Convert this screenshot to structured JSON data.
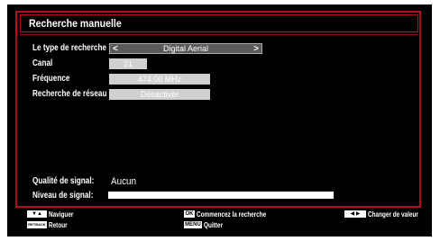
{
  "title": "Recherche manuelle",
  "rows": [
    {
      "label": "Le type de recherche",
      "value": "Digital Aerial",
      "left_arrow": "<",
      "right_arrow": ">"
    },
    {
      "label": "Canal",
      "value": "21"
    },
    {
      "label": "Fréquence",
      "value": "474.00 MHz"
    },
    {
      "label": "Recherche de réseau",
      "value": "Désactiver"
    }
  ],
  "signal_quality": {
    "label": "Qualité de signal:",
    "value": "Aucun"
  },
  "signal_level": {
    "label": "Niveau de signal:",
    "level": 1.0
  },
  "footer": {
    "navigate": {
      "key": "▼▲",
      "label": "Naviguer"
    },
    "back": {
      "key": "RETBACK",
      "label": "Retour"
    },
    "ok": {
      "key": "OK",
      "label": "Commencez la recherche"
    },
    "menu": {
      "key": "MENU",
      "label": "Quitter"
    },
    "change": {
      "key": "◀ ▶",
      "label": "Changer de valeur"
    }
  },
  "colors": {
    "frame": "#b0101a",
    "background": "#000000"
  }
}
